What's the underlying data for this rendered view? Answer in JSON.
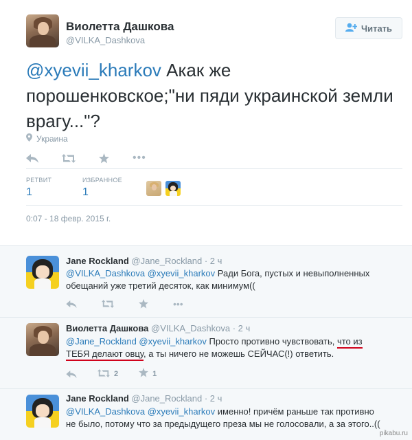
{
  "tweet": {
    "author_name": "Виолетта Дашкова",
    "author_handle": "@VILKA_Dashkova",
    "follow_label": "Читать",
    "text_mention": "@xyevii_kharkov",
    "text_body": " Акак же порошенковское;\"ни пяди украинской земли врагу...\"?",
    "location": "Украина",
    "retweets_label": "РЕТВИТ",
    "retweets_count": "1",
    "favorites_label": "ИЗБРАННОЕ",
    "favorites_count": "1",
    "timestamp": "0:07 - 18 февр. 2015 г."
  },
  "replies": [
    {
      "name": "Jane Rockland",
      "handle": "@Jane_Rockland",
      "time": "2 ч",
      "mentions": "@VILKA_Dashkova @xyevii_kharkov",
      "text_line1": " Ради Бога, пустых и невыполненных",
      "text_line2": "обещаний уже третий десяток, как минимум(("
    },
    {
      "name": "Виолетта Дашкова",
      "handle": "@VILKA_Dashkova",
      "time": "2 ч",
      "mentions": "@Jane_Rockland @xyevii_kharkov",
      "text_line1_a": " Просто противно чувствовать, ",
      "text_line1_b": "что из",
      "text_line2_a": "ТЕБЯ делают овцу",
      "text_line2_b": ", а ты ничего не можешь СЕЙЧАС(!) ответить.",
      "retweets": "2",
      "favorites": "1"
    },
    {
      "name": "Jane Rockland",
      "handle": "@Jane_Rockland",
      "time": "2 ч",
      "mentions": "@VILKA_Dashkova @xyevii_kharkov",
      "text_line1": " именно! причём раньше так противно",
      "text_line2": "не было, потому что за предыдущего преза мы не голосовали, а за этого..(("
    }
  ],
  "watermark": "pikabu.ru",
  "icons": {
    "reply": "reply-icon",
    "retweet": "retweet-icon",
    "favorite": "star-icon",
    "more": "more-icon",
    "location": "location-pin-icon",
    "follow": "add-user-icon"
  },
  "colors": {
    "link": "#2b7bb9",
    "muted": "#8899a6",
    "action": "#aab8c2",
    "reply_bg": "#f5f8fa",
    "annotation": "#d0021b"
  }
}
